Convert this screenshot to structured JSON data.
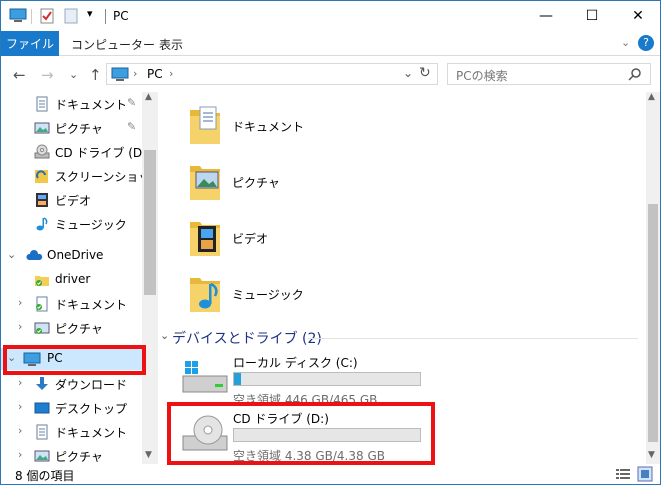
{
  "window": {
    "title": "PC",
    "minimize": "—",
    "maximize": "☐",
    "close": "✕"
  },
  "ribbon": {
    "tabs": [
      "ファイル",
      "コンピューター",
      "表示"
    ],
    "expand": "⌄",
    "help": "?"
  },
  "address": {
    "back": "←",
    "forward": "→",
    "recent": "⌄",
    "up": "↑",
    "path": "PC",
    "path_sep": "›",
    "dropdown": "⌄",
    "refresh": "↻",
    "search_placeholder": "PCの検索"
  },
  "nav": {
    "quick_access": [
      {
        "label": "ドキュメント",
        "icon": "document-icon",
        "pinned": true
      },
      {
        "label": "ピクチャ",
        "icon": "pictures-icon",
        "pinned": true
      },
      {
        "label": "CD ドライブ (D:)",
        "icon": "cd-drive-icon",
        "pinned": false
      },
      {
        "label": "スクリーンショット",
        "icon": "screenshot-icon",
        "pinned": false
      },
      {
        "label": "ビデオ",
        "icon": "video-icon",
        "pinned": false
      },
      {
        "label": "ミュージック",
        "icon": "music-icon",
        "pinned": false
      }
    ],
    "onedrive": {
      "label": "OneDrive"
    },
    "onedrive_items": [
      {
        "label": "driver"
      },
      {
        "label": "ドキュメント"
      },
      {
        "label": "ピクチャ"
      }
    ],
    "pc": {
      "label": "PC"
    },
    "pc_items": [
      {
        "label": "ダウンロード"
      },
      {
        "label": "デスクトップ"
      },
      {
        "label": "ドキュメント"
      },
      {
        "label": "ピクチャ"
      }
    ],
    "pin_glyph": "📌"
  },
  "content": {
    "folders": [
      {
        "label": "ドキュメント",
        "icon": "documents-folder-icon"
      },
      {
        "label": "ピクチャ",
        "icon": "pictures-folder-icon"
      },
      {
        "label": "ビデオ",
        "icon": "videos-folder-icon"
      },
      {
        "label": "ミュージック",
        "icon": "music-folder-icon"
      }
    ],
    "section_header": "デバイスとドライブ (2)",
    "drives": [
      {
        "name": "ローカル ディスク (C:)",
        "free": "空き領域 446 GB/465 GB",
        "used_fraction": 0.04
      },
      {
        "name": "CD ドライブ (D:)",
        "free": "空き領域 4.38 GB/4.38 GB",
        "used_fraction": 0.0
      }
    ]
  },
  "status": {
    "item_count": "8 個の項目"
  },
  "colors": {
    "accent": "#1979ca",
    "highlight": "#ee1111",
    "selection": "#cce8ff",
    "drive_bar": "#26a0da"
  }
}
